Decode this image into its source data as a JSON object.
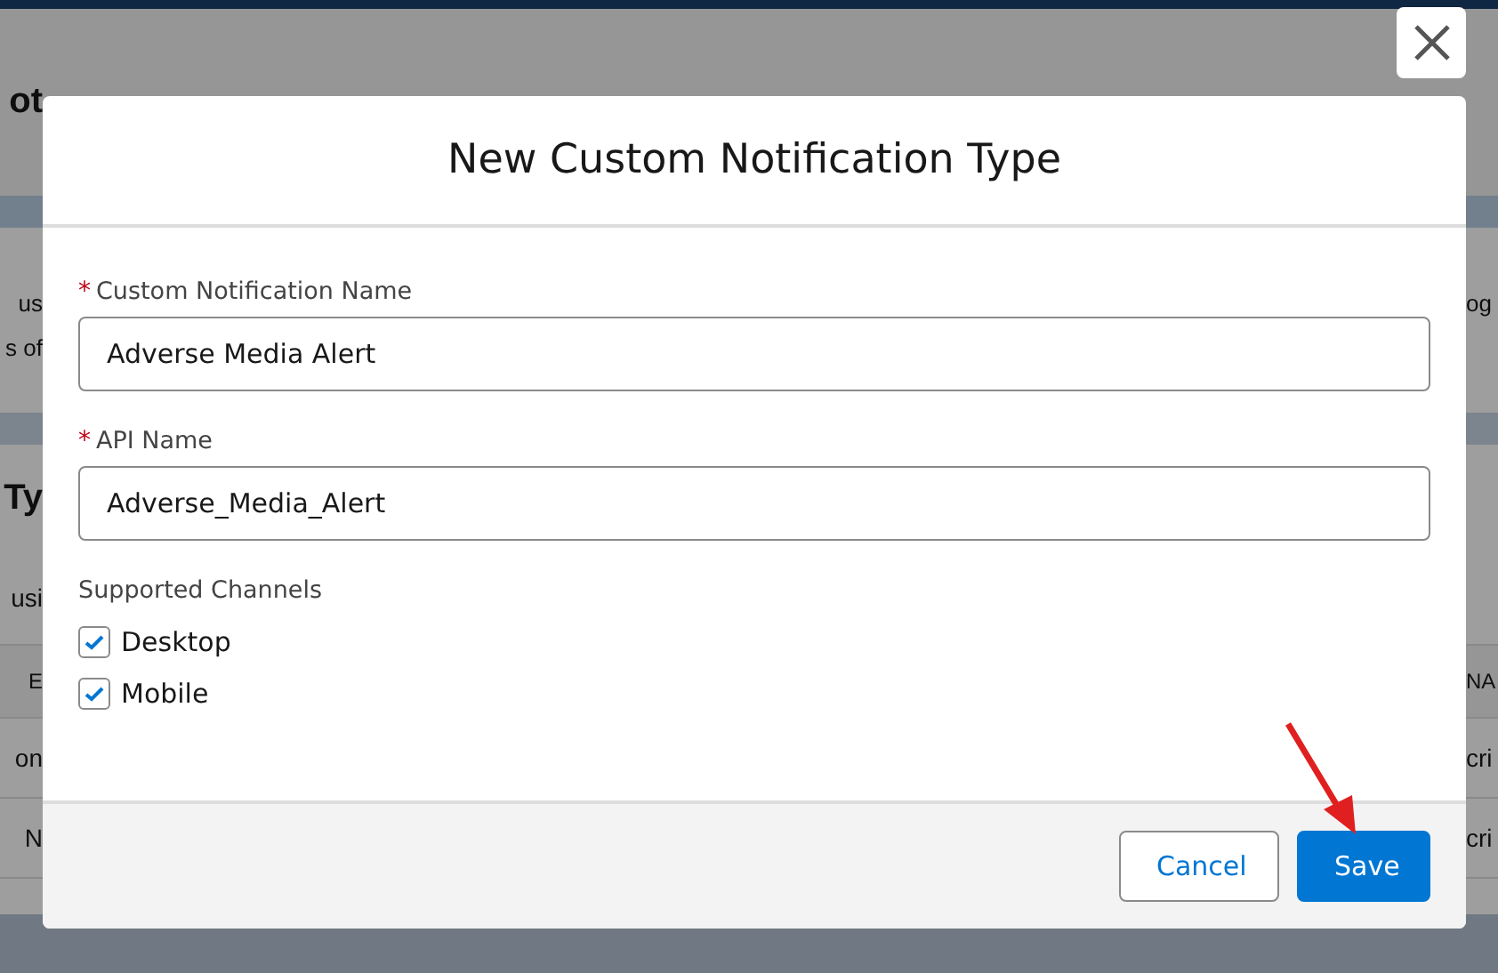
{
  "background": {
    "heading": "ot",
    "description_lines": [
      {
        "left": "us",
        "right": "og"
      },
      {
        "left": "s of"
      }
    ],
    "section_title": "Ty",
    "section_text": "usi",
    "table": {
      "columns": [
        "E",
        "NA"
      ],
      "rows": [
        [
          "on",
          "cri"
        ],
        [
          "N",
          "cri"
        ]
      ]
    }
  },
  "modal": {
    "title": "New Custom Notification Type",
    "fields": [
      {
        "label": "Custom Notification Name",
        "required_mark": "*",
        "value": "Adverse Media Alert"
      },
      {
        "label": "API Name",
        "required_mark": "*",
        "value": "Adverse_Media_Alert"
      }
    ],
    "channels": {
      "label": "Supported Channels",
      "options": [
        {
          "label": "Desktop",
          "checked": true
        },
        {
          "label": "Mobile",
          "checked": true
        }
      ]
    },
    "buttons": [
      {
        "label": "Cancel",
        "kind": "neutral"
      },
      {
        "label": "Save",
        "kind": "brand"
      }
    ]
  }
}
